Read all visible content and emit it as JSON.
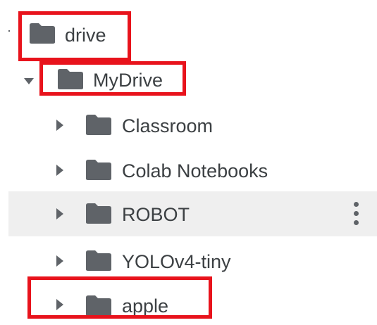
{
  "tree": {
    "drive": {
      "label": "drive"
    },
    "mydrive": {
      "label": "MyDrive"
    },
    "children": [
      {
        "label": "Classroom"
      },
      {
        "label": "Colab Notebooks"
      },
      {
        "label": "ROBOT"
      },
      {
        "label": "YOLOv4-tiny"
      },
      {
        "label": "apple"
      }
    ]
  },
  "colors": {
    "annotation_red": "#e8131c",
    "folder_gray": "#5f6368",
    "row_highlight": "#efefef",
    "text": "#3c4043"
  },
  "icons": {
    "folder": "folder-icon",
    "expand": "chevron-right-icon",
    "collapse": "chevron-down-icon",
    "more": "more-vertical-icon"
  }
}
